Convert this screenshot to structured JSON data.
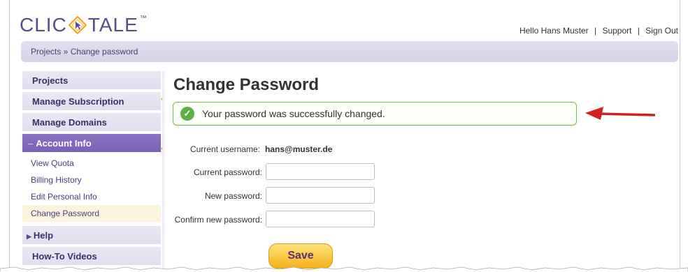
{
  "logo": {
    "text_left": "CLIC",
    "text_right": "TALE",
    "tm": "™"
  },
  "userbar": {
    "greeting": "Hello Hans Muster",
    "support": "Support",
    "signout": "Sign Out",
    "separator": "|"
  },
  "breadcrumb": {
    "text": "Projects » Change password"
  },
  "sidebar": {
    "projects": "Projects",
    "manage_subscription": "Manage Subscription",
    "manage_domains": "Manage Domains",
    "account_info": "Account Info",
    "account_dash": "–",
    "sub_items": [
      "View Quota",
      "Billing History",
      "Edit Personal Info",
      "Change Password"
    ],
    "help": "Help",
    "howto": "How-To Videos"
  },
  "main": {
    "title": "Change Password",
    "alert_message": "Your password was successfully changed.",
    "username_label": "Current username:",
    "username_value": "hans@muster.de",
    "current_password_label": "Current password:",
    "new_password_label": "New password:",
    "confirm_password_label": "Confirm new password:",
    "current_password_value": "",
    "new_password_value": "",
    "confirm_password_value": "",
    "save_label": "Save"
  },
  "colors": {
    "brand_purple": "#5b4b8a",
    "accent_orange": "#f0a823",
    "success_green": "#5cb044",
    "arrow_red": "#d42020"
  },
  "icons": {
    "logo_mark": "diamond-cursor-icon",
    "success": "check-circle-icon",
    "arrow": "red-arrow-icon",
    "expand": "triangle-right-icon"
  }
}
